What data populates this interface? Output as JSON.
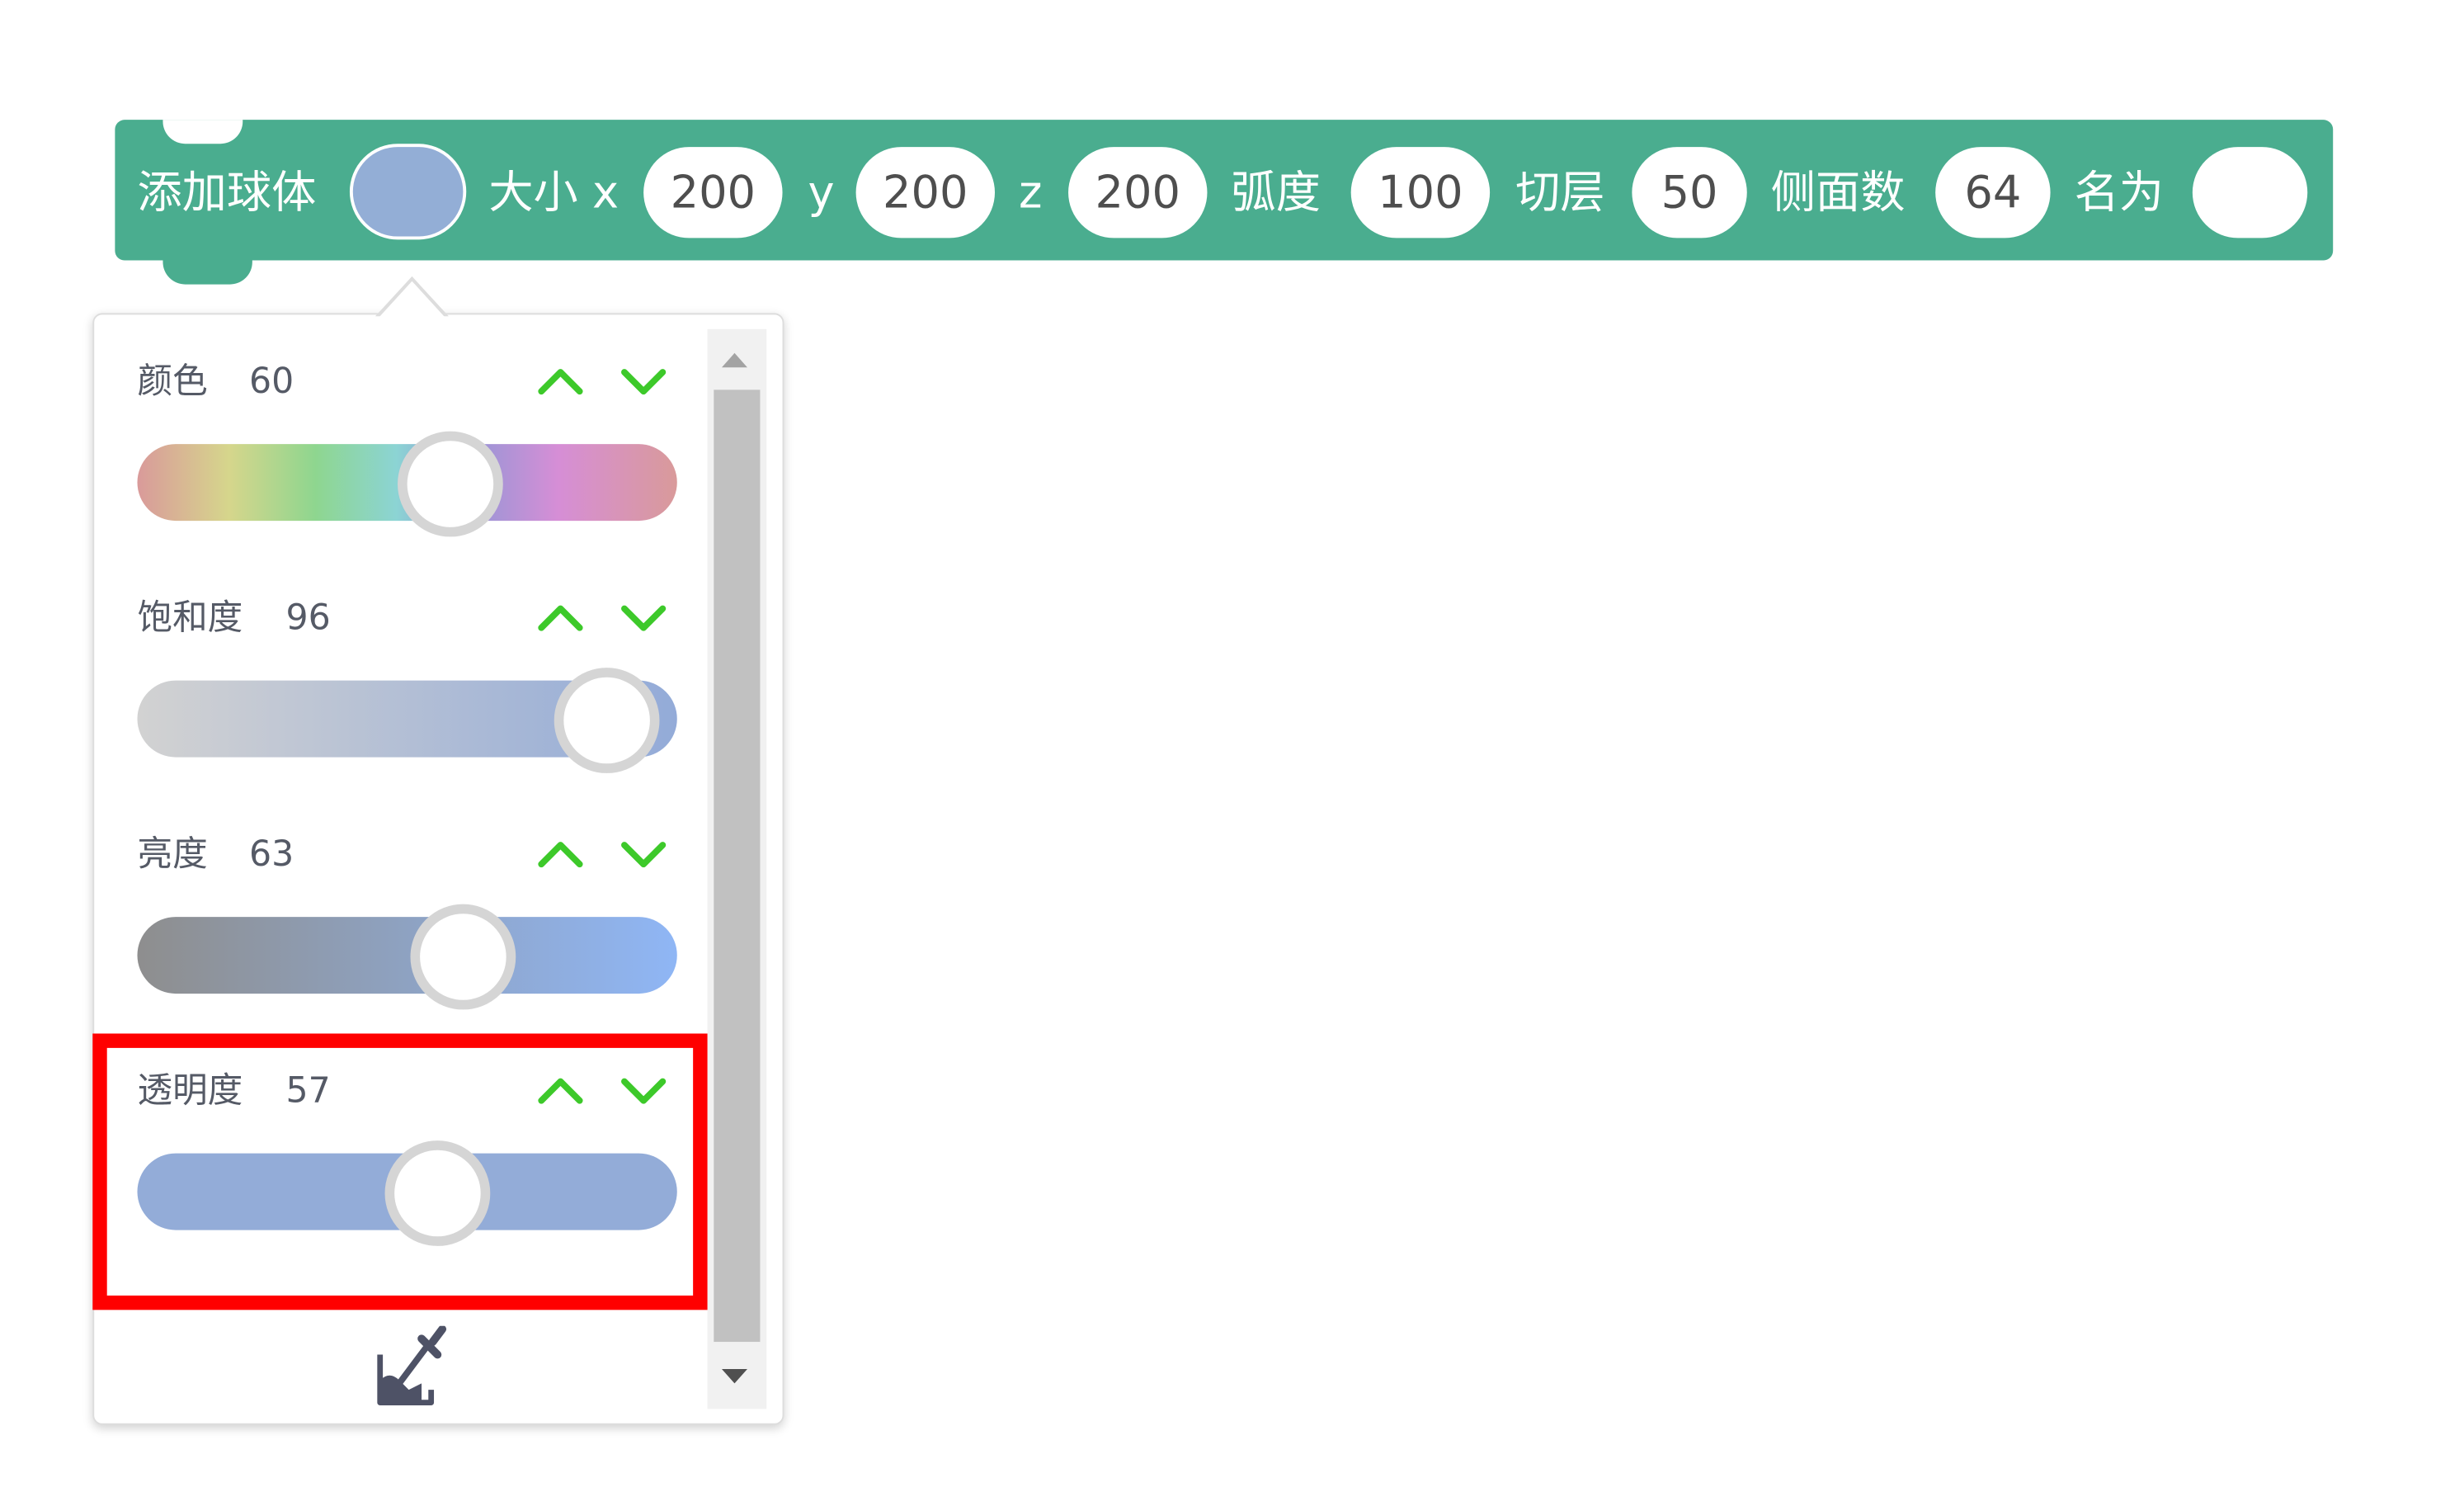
{
  "block": {
    "title": "添加球体",
    "size_label": "大小 x",
    "x_value": "200",
    "y_label": "y",
    "y_value": "200",
    "z_label": "z",
    "z_value": "200",
    "arc_label": "弧度",
    "arc_value": "100",
    "slice_label": "切层",
    "slice_value": "50",
    "sides_label": "侧面数",
    "sides_value": "64",
    "name_label": "名为",
    "name_value": "",
    "block_color": "#4aad8f",
    "swatch_color": "#93aed6"
  },
  "picker": {
    "hue": {
      "label": "颜色",
      "value": "60",
      "level": 0.6
    },
    "saturation": {
      "label": "饱和度",
      "value": "96",
      "level": 0.96
    },
    "brightness": {
      "label": "亮度",
      "value": "63",
      "level": 0.63
    },
    "transparency": {
      "label": "透明度",
      "value": "57",
      "level": 0.57
    },
    "up_icon": "chevron-up-icon",
    "down_icon": "chevron-down-icon",
    "arrow_color": "#3dc92a",
    "eyedropper_icon": "eyedropper-icon"
  },
  "highlight_color": "#ff0000"
}
